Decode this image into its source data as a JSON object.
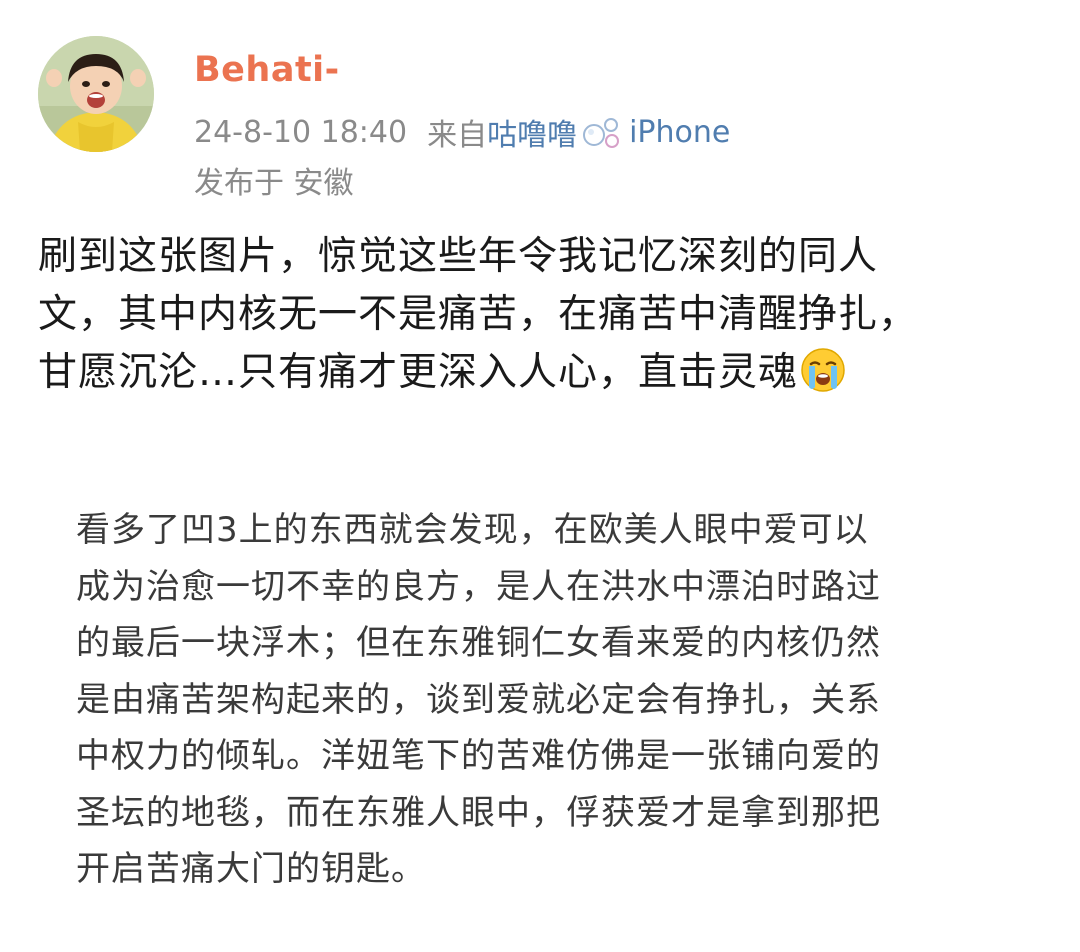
{
  "post": {
    "author": {
      "username": "Behati-",
      "avatar_icon": "child-photo-avatar"
    },
    "timestamp": "24-8-10 18:40",
    "source_prefix": "来自",
    "source_app": "咕噜噜",
    "source_icon": "bubbles-icon",
    "source_device": "iPhone",
    "location": "发布于 安徽",
    "body_lines": [
      "刷到这张图片，惊觉这些年令我记忆深刻的同人",
      "文，其中内核无一不是痛苦，在痛苦中清醒挣扎，",
      "甘愿沉沦…只有痛才更深入人心，直击灵魂"
    ],
    "body_emoji": "crying-face-emoji"
  },
  "quoted_image": {
    "lines": [
      "看多了凹3上的东西就会发现，在欧美人眼中爱可以",
      "成为治愈一切不幸的良方，是人在洪水中漂泊时路过",
      "的最后一块浮木；但在东雅铜仁女看来爱的内核仍然",
      "是由痛苦架构起来的，谈到爱就必定会有挣扎，关系",
      "中权力的倾轧。洋妞笔下的苦难仿佛是一张铺向爱的",
      "圣坛的地毯，而在东雅人眼中，俘获爱才是拿到那把",
      "开启苦痛大门的钥匙。"
    ]
  },
  "colors": {
    "username": "#eb7350",
    "meta": "#8a8a8a",
    "link": "#507daf",
    "body_text": "#1a1a1a",
    "quoted_text": "#3a3a3a"
  }
}
